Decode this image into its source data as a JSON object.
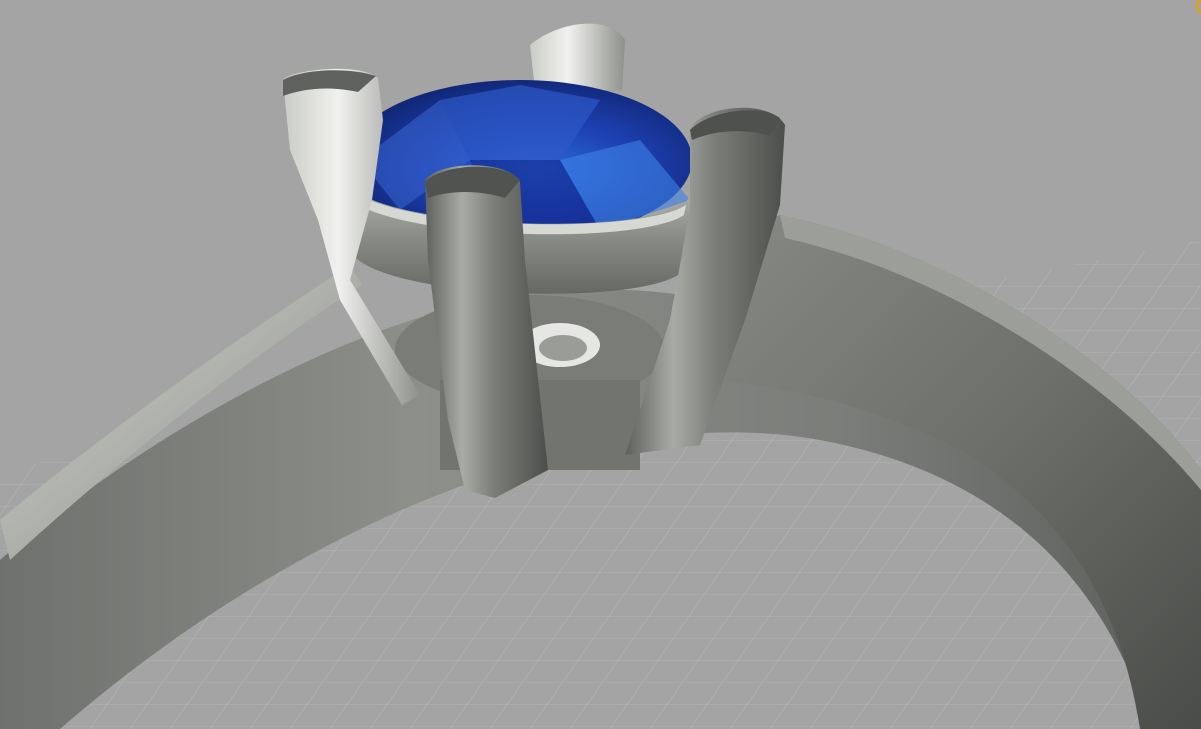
{
  "viewport": {
    "name": "3d-perspective-viewport",
    "background_color": "#a4a4a4",
    "grid_color": "#b9b9b9",
    "model": {
      "object": "solitaire-ring",
      "metal_color": "#8c8d8a",
      "gem_color": "#1f45b8",
      "prong_count": 4
    },
    "corner_marker_color": "#e7a400"
  }
}
